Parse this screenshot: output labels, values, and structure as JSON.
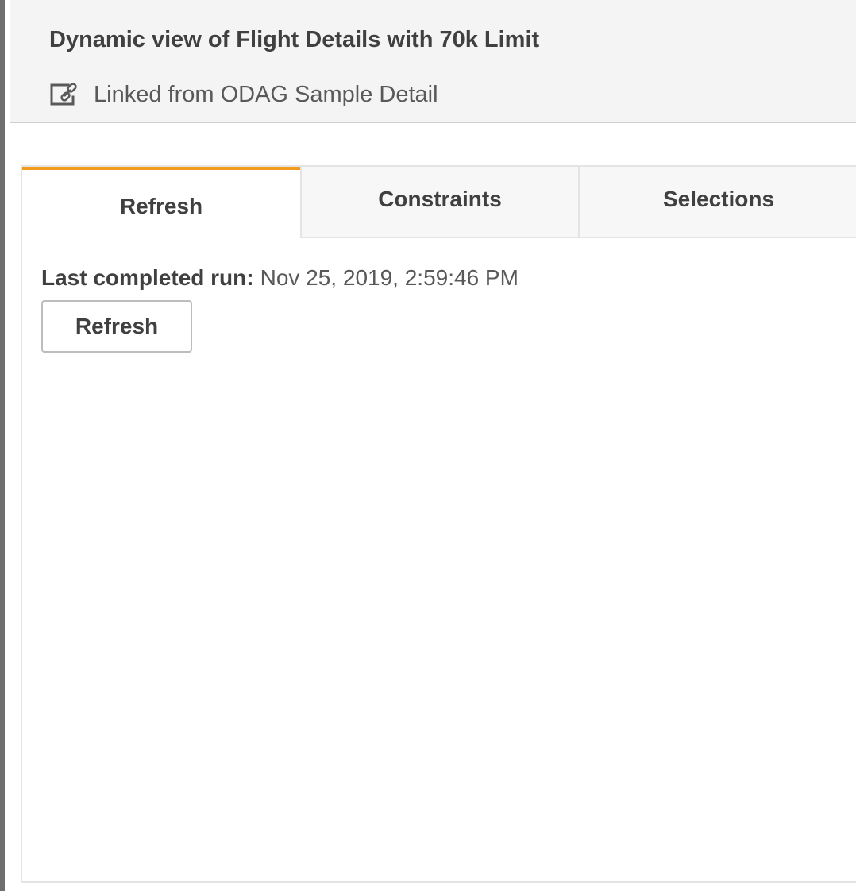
{
  "header": {
    "title": "Dynamic view of Flight Details with 70k Limit",
    "link_icon": "link-icon",
    "subtitle": "Linked from ODAG Sample Detail"
  },
  "tabs": [
    {
      "label": "Refresh",
      "active": true
    },
    {
      "label": "Constraints",
      "active": false
    },
    {
      "label": "Selections",
      "active": false
    }
  ],
  "refresh_panel": {
    "last_run_label": "Last completed run:",
    "last_run_value": "Nov 25, 2019, 2:59:46 PM",
    "refresh_button_label": "Refresh"
  },
  "colors": {
    "active_tab_accent": "#f19a1b",
    "header_background": "#f4f4f4",
    "text_primary": "#404040"
  }
}
